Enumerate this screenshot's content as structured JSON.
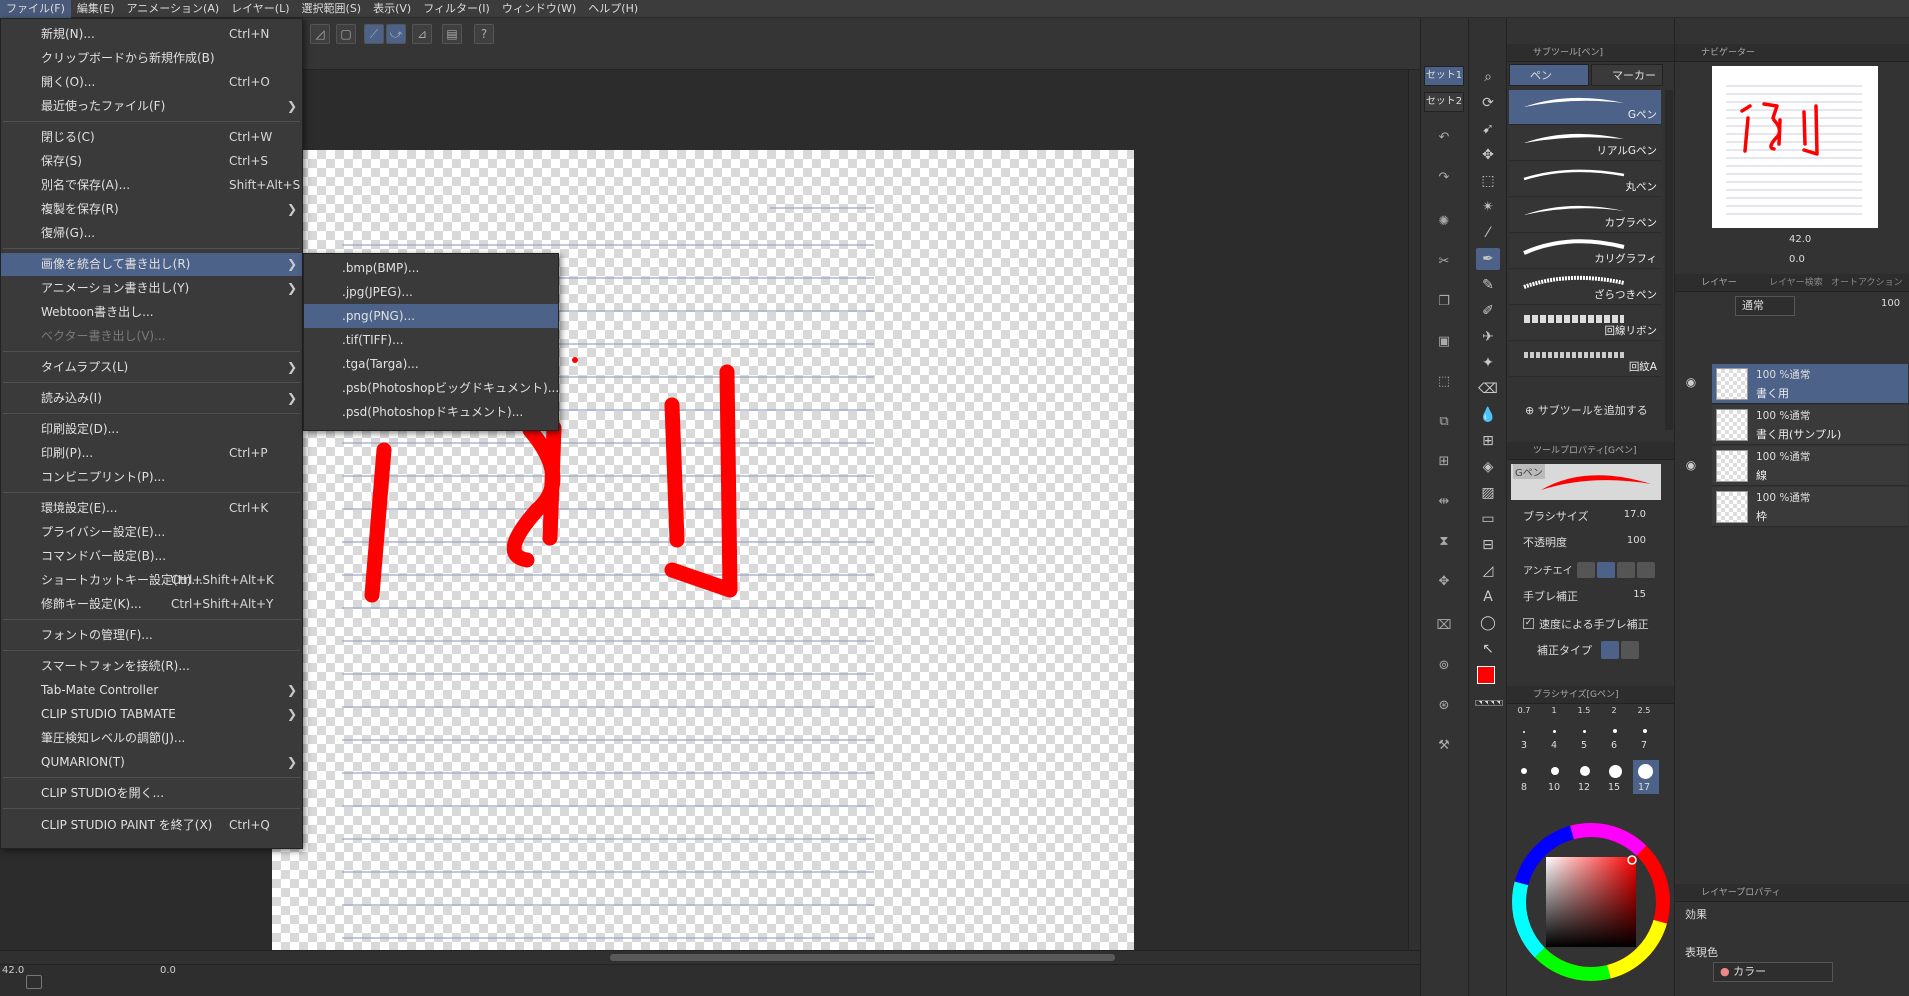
{
  "menubar": {
    "items": [
      "ファイル(F)",
      "編集(E)",
      "アニメーション(A)",
      "レイヤー(L)",
      "選択範囲(S)",
      "表示(V)",
      "フィルター(I)",
      "ウィンドウ(W)",
      "ヘルプ(H)"
    ]
  },
  "file_menu": {
    "items": [
      {
        "label": "新規(N)...",
        "shortcut": "Ctrl+N"
      },
      {
        "label": "クリップボードから新規作成(B)",
        "shortcut": ""
      },
      {
        "label": "開く(O)...",
        "shortcut": "Ctrl+O"
      },
      {
        "label": "最近使ったファイル(F)",
        "shortcut": "",
        "arrow": "❯"
      },
      {
        "label": "閉じる(C)",
        "shortcut": "Ctrl+W"
      },
      {
        "label": "保存(S)",
        "shortcut": "Ctrl+S"
      },
      {
        "label": "別名で保存(A)...",
        "shortcut": "Shift+Alt+S"
      },
      {
        "label": "複製を保存(R)",
        "shortcut": "",
        "arrow": "❯"
      },
      {
        "label": "復帰(G)...",
        "shortcut": ""
      },
      {
        "label": "画像を統合して書き出し(R)",
        "shortcut": "",
        "arrow": "❯"
      },
      {
        "label": "アニメーション書き出し(Y)",
        "shortcut": "",
        "arrow": "❯"
      },
      {
        "label": "Webtoon書き出し...",
        "shortcut": ""
      },
      {
        "label": "ベクター書き出し(V)...",
        "shortcut": ""
      },
      {
        "label": "タイムラプス(L)",
        "shortcut": "",
        "arrow": "❯"
      },
      {
        "label": "読み込み(I)",
        "shortcut": "",
        "arrow": "❯"
      },
      {
        "label": "印刷設定(D)...",
        "shortcut": ""
      },
      {
        "label": "印刷(P)...",
        "shortcut": "Ctrl+P"
      },
      {
        "label": "コンビニプリント(P)...",
        "shortcut": ""
      },
      {
        "label": "環境設定(E)...",
        "shortcut": "Ctrl+K"
      },
      {
        "label": "プライバシー設定(E)...",
        "shortcut": ""
      },
      {
        "label": "コマンドバー設定(B)...",
        "shortcut": ""
      },
      {
        "label": "ショートカットキー設定(H)...",
        "shortcut": "Ctrl+Shift+Alt+K"
      },
      {
        "label": "修飾キー設定(K)...",
        "shortcut": "Ctrl+Shift+Alt+Y"
      },
      {
        "label": "フォントの管理(F)...",
        "shortcut": ""
      },
      {
        "label": "スマートフォンを接続(R)...",
        "shortcut": ""
      },
      {
        "label": "Tab-Mate Controller",
        "shortcut": "",
        "arrow": "❯"
      },
      {
        "label": "CLIP STUDIO TABMATE",
        "shortcut": "",
        "arrow": "❯"
      },
      {
        "label": "筆圧検知レベルの調節(J)...",
        "shortcut": ""
      },
      {
        "label": "QUMARION(T)",
        "shortcut": "",
        "arrow": "❯"
      },
      {
        "label": "CLIP STUDIOを開く...",
        "shortcut": ""
      },
      {
        "label": "CLIP STUDIO PAINT を終了(X)",
        "shortcut": "Ctrl+Q"
      }
    ]
  },
  "export_submenu": {
    "items": [
      ".bmp(BMP)...",
      ".jpg(JPEG)...",
      ".png(PNG)...",
      ".tif(TIFF)...",
      ".tga(Targa)...",
      ".psb(Photoshopビッグドキュメント)...",
      ".psd(Photoshopドキュメント)..."
    ]
  },
  "canvas": {
    "character": "例",
    "stroke_color": "#ff0000"
  },
  "status": {
    "zoom": "42.0",
    "rotation": "0.0"
  },
  "set_tabs": [
    "セット1",
    "セット2"
  ],
  "subtool": {
    "title": "サブツール[ペン]",
    "tabs": [
      "ペン",
      "マーカー"
    ],
    "brushes": [
      "Gペン",
      "リアルGペン",
      "丸ペン",
      "カブラペン",
      "カリグラフィ",
      "ざらつきペン",
      "回線リボン",
      "回紋A"
    ],
    "add_label": "サブツールを追加する"
  },
  "tool_property": {
    "title": "ツールプロパティ[Gペン]",
    "preview_label": "Gペン",
    "brush_size_label": "ブラシサイズ",
    "brush_size_value": "17.0",
    "opacity_label": "不透明度",
    "opacity_value": "100",
    "antialias_label": "アンチエイ",
    "stabilization_label": "手ブレ補正",
    "stabilization_value": "15",
    "speed_label": "速度による手ブレ補正",
    "correction_label": "補正タイプ"
  },
  "brush_size_panel": {
    "title": "ブラシサイズ[Gペン]",
    "sizes_top": [
      "0.7",
      "1",
      "1.5",
      "2",
      "2.5"
    ],
    "row1": [
      "3",
      "4",
      "5",
      "6",
      "7"
    ],
    "row2": [
      "8",
      "10",
      "12",
      "15",
      "17"
    ]
  },
  "color": {
    "main": "#ff0000",
    "sub": "#0000ff",
    "values": "0 100 100"
  },
  "navigator": {
    "title": "ナビゲーター",
    "zoom": "42.0",
    "rotation": "0.0"
  },
  "layer_panel": {
    "title": "レイヤー",
    "tab2": "レイヤー検索",
    "tab3": "オートアクション",
    "blend_mode": "通常",
    "opacity": "100",
    "layers": [
      {
        "mode": "100 %通常",
        "name": "書く用"
      },
      {
        "mode": "100 %通常",
        "name": "書く用(サンプル)"
      },
      {
        "mode": "100 %通常",
        "name": "線"
      },
      {
        "mode": "100 %通常",
        "name": "枠"
      }
    ]
  },
  "layer_property": {
    "title": "レイヤープロパティ",
    "effect_label": "効果",
    "expression_label": "表現色",
    "expression_value": "カラー"
  }
}
